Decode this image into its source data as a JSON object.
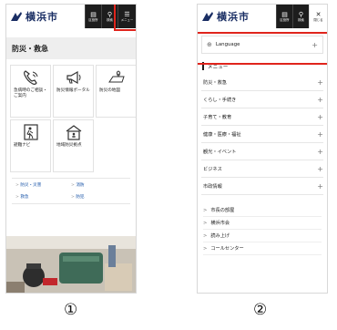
{
  "logo": {
    "text": "横浜市"
  },
  "left": {
    "header_buttons": [
      {
        "icon": "document-icon",
        "glyph": "▤",
        "label": "区役所"
      },
      {
        "icon": "search-icon",
        "glyph": "⚲",
        "label": "検索"
      },
      {
        "icon": "menu-icon",
        "glyph": "☰",
        "label": "メニュー"
      }
    ],
    "page_title": "防災・救急",
    "tiles": [
      {
        "icon": "phone-icon",
        "label": "急病時のご相談・ご案内"
      },
      {
        "icon": "megaphone-icon",
        "label": "防災情報ポータル"
      },
      {
        "icon": "map-pin-icon",
        "label": "防災の地図"
      },
      {
        "icon": "evacuation-icon",
        "label": "避難ナビ"
      },
      {
        "icon": "shelter-icon",
        "label": "地域防災拠点"
      }
    ],
    "links": [
      "防災・災害",
      "消防",
      "救急",
      "防犯"
    ],
    "caption": "①"
  },
  "right": {
    "header_buttons": [
      {
        "icon": "document-icon",
        "glyph": "▤",
        "label": "区役所"
      },
      {
        "icon": "search-icon",
        "glyph": "⚲",
        "label": "検索"
      },
      {
        "icon": "close-icon",
        "glyph": "✕",
        "label": "閉じる"
      }
    ],
    "language": "Language",
    "menu_heading": "メニュー",
    "menu_items": [
      "防災・救急",
      "くらし・手続き",
      "子育て・教育",
      "健康・医療・福祉",
      "観光・イベント",
      "ビジネス",
      "市政情報"
    ],
    "sub_items": [
      "市長の部屋",
      "横浜市会",
      "読み上げ",
      "コールセンター"
    ],
    "caption": "②"
  },
  "colors": {
    "highlight": "#e0241c",
    "header_dark": "#1d1d1d",
    "logo": "#1a2e64",
    "link": "#1a55a8"
  }
}
